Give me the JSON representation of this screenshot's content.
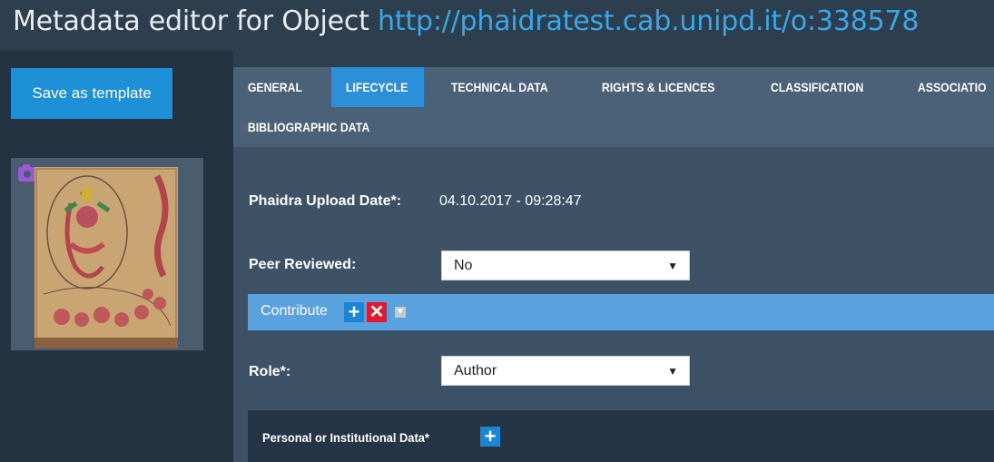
{
  "header": {
    "title_prefix": "Metadata editor for Object ",
    "object_link": "http://phaidratest.cab.unipd.it/o:338578"
  },
  "sidebar": {
    "save_template_label": "Save as template"
  },
  "tabs": [
    {
      "label": "GENERAL",
      "active": false
    },
    {
      "label": "LIFECYCLE",
      "active": true
    },
    {
      "label": "TECHNICAL DATA",
      "active": false
    },
    {
      "label": "RIGHTS & LICENCES",
      "active": false
    },
    {
      "label": "CLASSIFICATION",
      "active": false
    },
    {
      "label": "ASSOCIATIO",
      "active": false
    },
    {
      "label": "BIBLIOGRAPHIC DATA",
      "active": false
    }
  ],
  "form": {
    "upload_date_label": "Phaidra Upload Date*:",
    "upload_date_value": "04.10.2017 - 09:28:47",
    "peer_reviewed_label": "Peer Reviewed:",
    "peer_reviewed_value": "No",
    "contribute_label": "Contribute",
    "role_label": "Role*:",
    "role_value": "Author",
    "personal_data_label": "Personal or Institutional Data*"
  },
  "colors": {
    "accent": "#2b8fd9",
    "link": "#38a8e8",
    "remove": "#e8182c",
    "contribute_bar": "#5aa1e0"
  },
  "icons": [
    "camera-icon",
    "plus-icon",
    "remove-icon",
    "move-down-icon",
    "chevron-down-icon"
  ]
}
